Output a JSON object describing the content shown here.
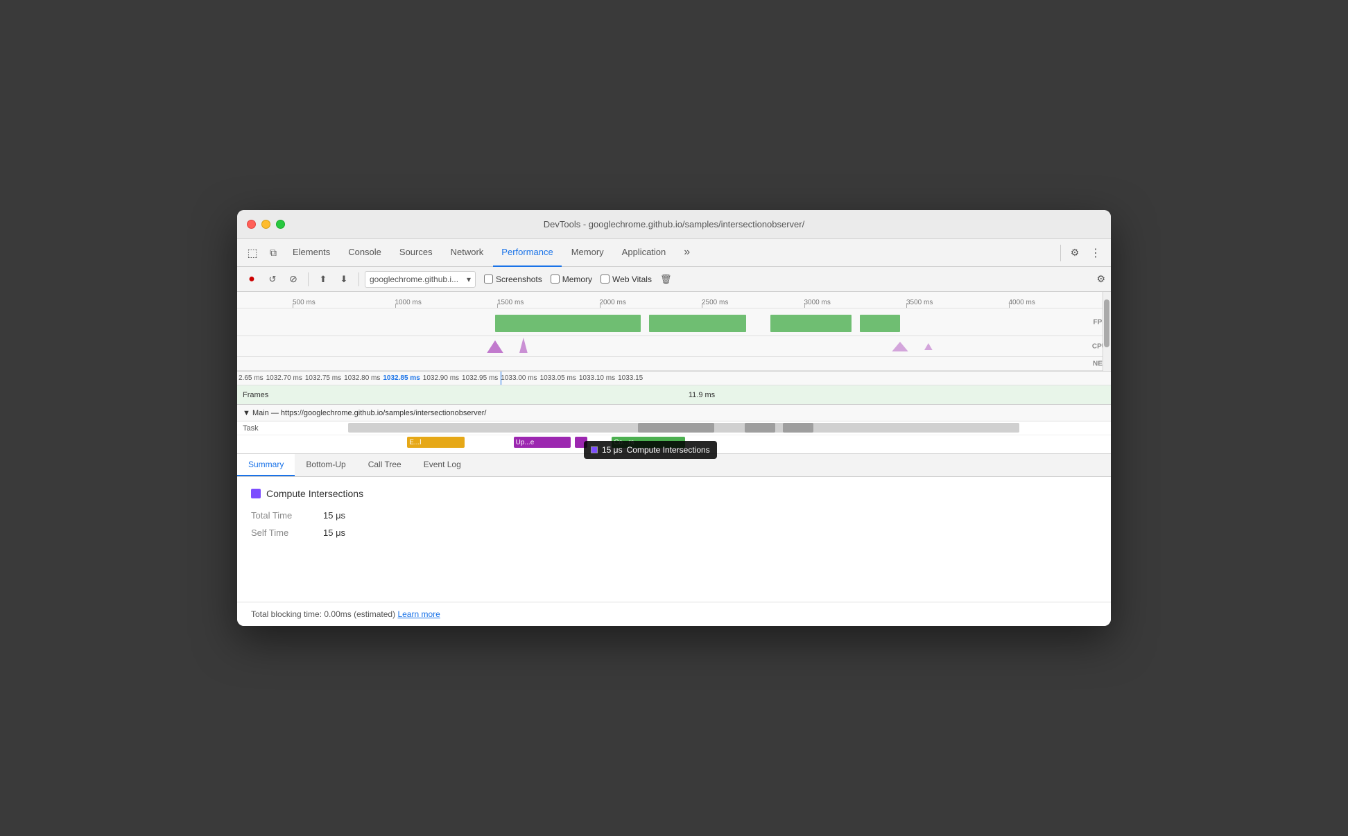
{
  "window": {
    "title": "DevTools - googlechrome.github.io/samples/intersectionobserver/"
  },
  "traffic_lights": {
    "red_label": "close",
    "yellow_label": "minimize",
    "green_label": "maximize"
  },
  "devtools_tabs": {
    "items": [
      {
        "label": "Elements",
        "active": false
      },
      {
        "label": "Console",
        "active": false
      },
      {
        "label": "Sources",
        "active": false
      },
      {
        "label": "Network",
        "active": false
      },
      {
        "label": "Performance",
        "active": true
      },
      {
        "label": "Memory",
        "active": false
      },
      {
        "label": "Application",
        "active": false
      }
    ],
    "more_label": "»",
    "settings_icon": "⚙",
    "dots_icon": "⋮"
  },
  "toolbar": {
    "record_icon": "●",
    "reload_icon": "↺",
    "stop_icon": "🚫",
    "upload_icon": "⬆",
    "download_icon": "⬇",
    "url_text": "googlechrome.github.i...",
    "url_dropdown_icon": "▾",
    "screenshots_label": "Screenshots",
    "memory_label": "Memory",
    "web_vitals_label": "Web Vitals",
    "trash_icon": "🗑",
    "settings_icon": "⚙"
  },
  "ruler": {
    "ticks": [
      "500 ms",
      "1000 ms",
      "1500 ms",
      "2000 ms",
      "2500 ms",
      "3000 ms",
      "3500 ms",
      "4000 ms"
    ],
    "fps_label": "FPS",
    "cpu_label": "CPU",
    "net_label": "NET"
  },
  "detail_ruler": {
    "labels": [
      "2.65 ms",
      "1032.70 ms",
      "1032.75 ms",
      "1032.80 ms",
      "1032.85 ms",
      "1032.90 ms",
      "1032.95 ms",
      "1033.00 ms",
      "1033.05 ms",
      "1033.10 ms",
      "1033.15"
    ]
  },
  "frames_row": {
    "label": "Frames",
    "frame_time": "11.9 ms"
  },
  "main_thread": {
    "label": "▼ Main — https://googlechrome.github.io/samples/intersectionobserver/"
  },
  "task_row": {
    "label": "Task"
  },
  "event_bars": [
    {
      "label": "E...l",
      "color": "#e6a817",
      "left": "14%",
      "width": "7%"
    },
    {
      "label": "Up...e",
      "color": "#9c27b0",
      "left": "27%",
      "width": "7%"
    },
    {
      "label": "",
      "color": "#9c27b0",
      "left": "34.5%",
      "width": "1%"
    },
    {
      "label": "Co...rs",
      "color": "#4caf50",
      "left": "39%",
      "width": "9%"
    }
  ],
  "tooltip": {
    "time": "15 μs",
    "label": "Compute Intersections"
  },
  "bottom_tabs": {
    "items": [
      {
        "label": "Summary",
        "active": true
      },
      {
        "label": "Bottom-Up",
        "active": false
      },
      {
        "label": "Call Tree",
        "active": false
      },
      {
        "label": "Event Log",
        "active": false
      }
    ]
  },
  "summary": {
    "title": "Compute Intersections",
    "color": "#7c4dff",
    "total_time_label": "Total Time",
    "total_time_value": "15 μs",
    "self_time_label": "Self Time",
    "self_time_value": "15 μs"
  },
  "footer": {
    "text": "Total blocking time: 0.00ms (estimated)",
    "learn_more_label": "Learn more"
  }
}
